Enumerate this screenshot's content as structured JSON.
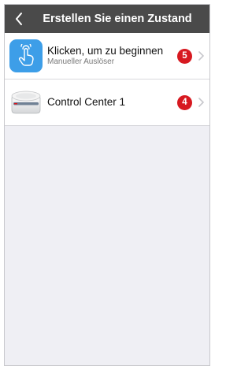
{
  "header": {
    "title": "Erstellen Sie einen Zustand",
    "back_icon": "chevron-left-icon"
  },
  "items": [
    {
      "title": "Klicken, um zu beginnen",
      "subtitle": "Manueller Auslöser",
      "badge": "5",
      "icon": "tap-hand-icon",
      "icon_color": "#3d9ee8"
    },
    {
      "title": "Control Center 1",
      "badge": "4",
      "icon": "control-center-device-icon"
    }
  ],
  "colors": {
    "nav_background": "#4a4a4a",
    "badge": "#d71920",
    "page_background": "#efeff4"
  }
}
